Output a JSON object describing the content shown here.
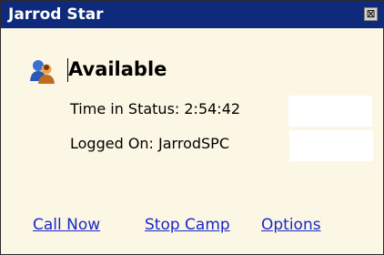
{
  "window": {
    "title": "Jarrod Star",
    "close_glyph": "⊠"
  },
  "status": {
    "icon": "user-status-icon",
    "label": "Available",
    "time_in_status": "Time in Status: 2:54:42",
    "logged_on": "Logged On: JarrodSPC"
  },
  "links": [
    {
      "label": "Call Now"
    },
    {
      "label": "Stop Camp"
    },
    {
      "label": "Options"
    }
  ],
  "colors": {
    "titlebar": "#0f2a7a",
    "panel": "#fbf7e4",
    "link": "#1a28c8"
  }
}
